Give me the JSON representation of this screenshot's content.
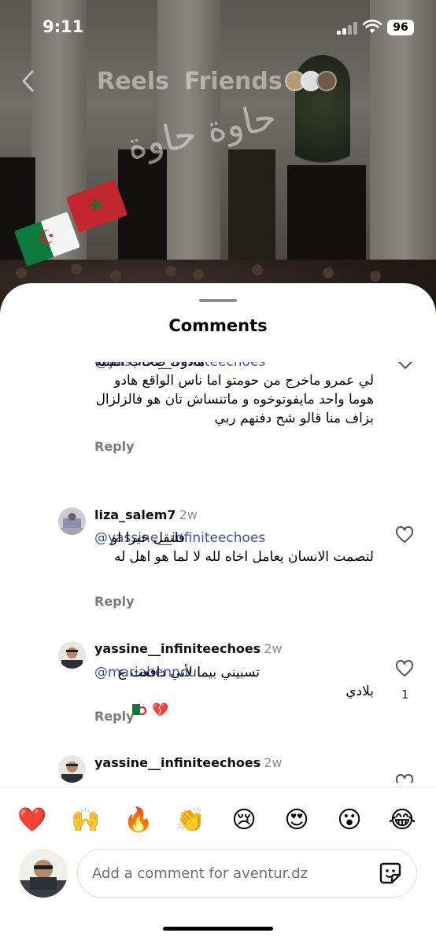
{
  "status_bar": {
    "time": "9:11",
    "battery": "96"
  },
  "reels_header": {
    "tab_reels": "Reels",
    "tab_friends": "Friends"
  },
  "video": {
    "calligraphy": "حاوة حاوة"
  },
  "sheet": {
    "title": "Comments"
  },
  "comments": [
    {
      "username": "",
      "age": "",
      "mention": "@yassine__infiniteechoes",
      "text": "هادوك صحاب الفتنة لي عمرو ماخرج من حومتو اما ناس الواقع هادو هوما واحد مايفوتوخوه و ماتنساش تان هو فالزلزال بزاف منا قالو شح دفنهم ربي",
      "reply": "Reply"
    },
    {
      "username": "liza_salem7",
      "age": "2w",
      "mention": "@yassine__infiniteechoes",
      "text": "فلتقل خيرا او لتصمت الانسان يعامل اخاه  لله لا لما هو اهل له",
      "reply": "Reply"
    },
    {
      "username": "yassine__infiniteechoes",
      "age": "2w",
      "mention": "@mariabennoui",
      "text": "تسبيني بيما لأني دافعت ع بلادي",
      "likes": "1",
      "reply": "Reply"
    },
    {
      "username": "yassine__infiniteechoes",
      "age": "2w"
    }
  ],
  "reactions": [
    "❤️",
    "🙌",
    "🔥",
    "👏",
    "😢",
    "😍",
    "😮",
    "😂"
  ],
  "composer": {
    "placeholder": "Add a comment for aventur.dz"
  },
  "colors": {
    "mention": "#3b4fb3",
    "muted": "#8e8e8e",
    "accent_red": "#ed4956"
  }
}
